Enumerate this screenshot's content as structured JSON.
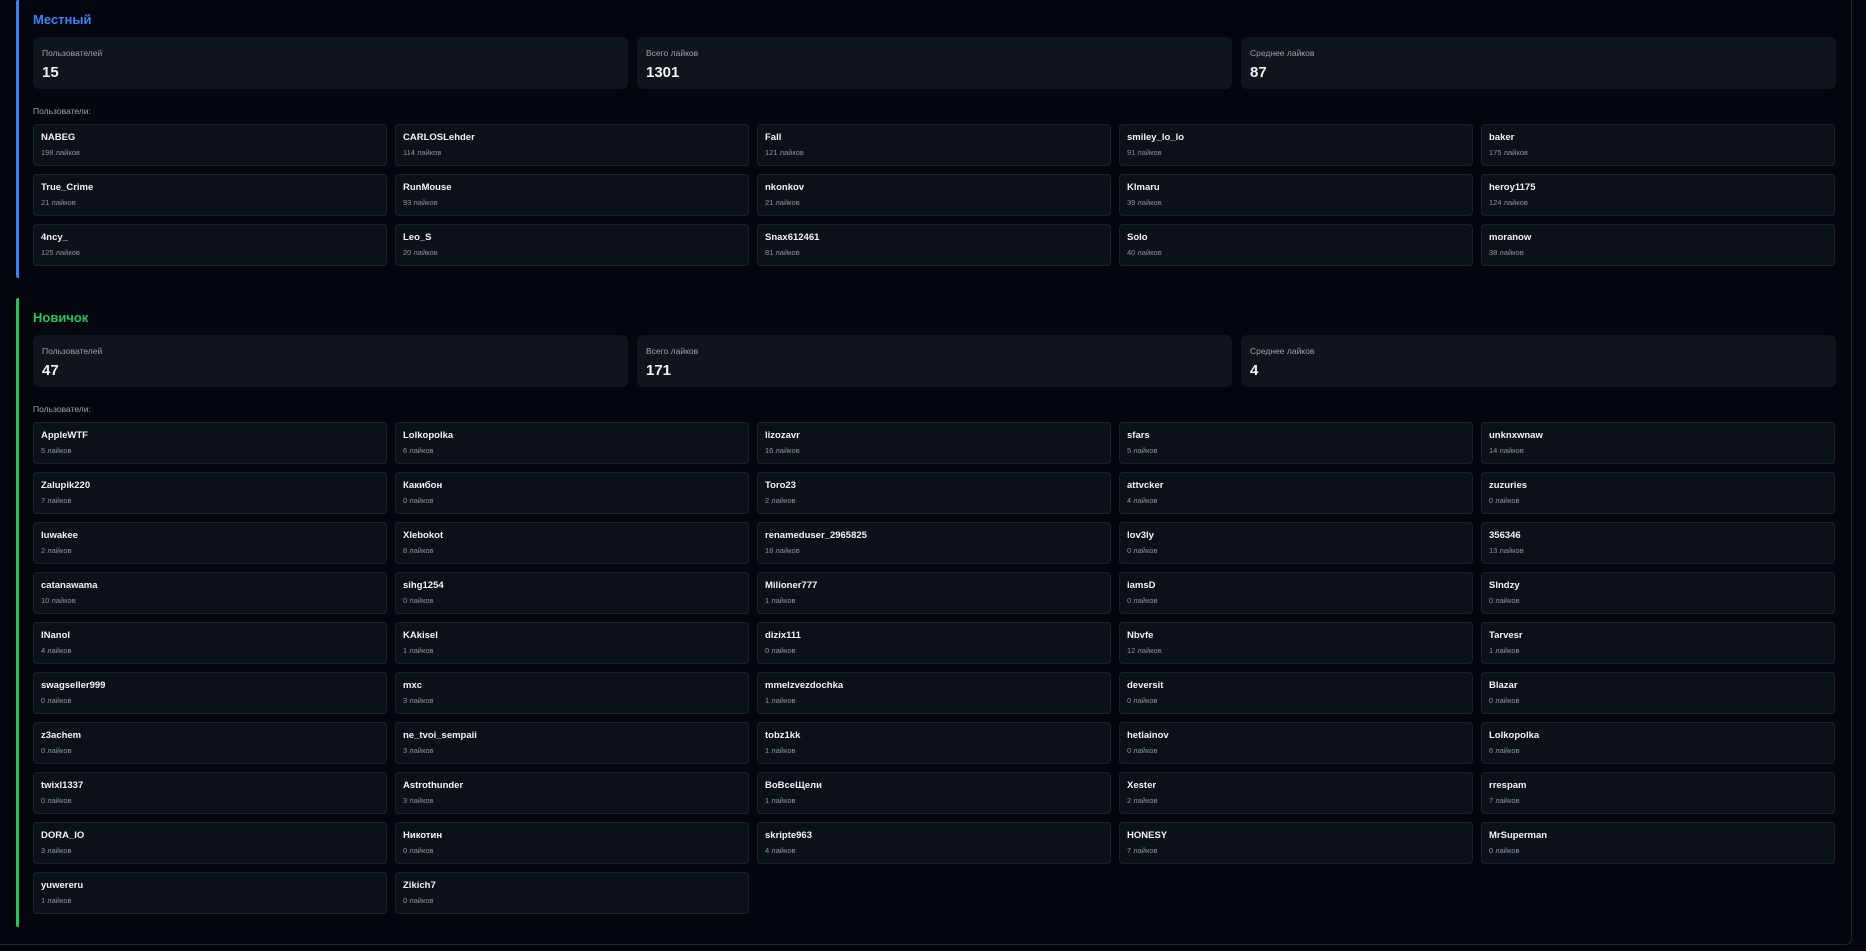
{
  "colors": {
    "background": "#04060d",
    "local_accent": "#3b82f6",
    "newbie_accent": "#22c55e"
  },
  "groups": [
    {
      "title": "Местный",
      "stats": [
        {
          "label": "Пользователей",
          "value": "15"
        },
        {
          "label": "Всего лайков",
          "value": "1301"
        },
        {
          "label": "Среднее лайков",
          "value": "87"
        }
      ],
      "users_label": "Пользователи:",
      "users": [
        {
          "name": "NABEG",
          "likes": "198 лайков"
        },
        {
          "name": "CARLOSLehder",
          "likes": "114 лайков"
        },
        {
          "name": "Fall",
          "likes": "121 лайков"
        },
        {
          "name": "smiley_lo_lo",
          "likes": "91 лайков"
        },
        {
          "name": "baker",
          "likes": "175 лайков"
        },
        {
          "name": "True_Crime",
          "likes": "21 лайков"
        },
        {
          "name": "RunMouse",
          "likes": "93 лайков"
        },
        {
          "name": "nkonkov",
          "likes": "21 лайков"
        },
        {
          "name": "Klmaru",
          "likes": "39 лайков"
        },
        {
          "name": "heroy1175",
          "likes": "124 лайков"
        },
        {
          "name": "4ncy_",
          "likes": "125 лайков"
        },
        {
          "name": "Leo_S",
          "likes": "20 лайков"
        },
        {
          "name": "Snax612461",
          "likes": "81 лайков"
        },
        {
          "name": "Solo",
          "likes": "40 лайков"
        },
        {
          "name": "moranow",
          "likes": "38 лайков"
        }
      ]
    },
    {
      "title": "Новичок",
      "stats": [
        {
          "label": "Пользователей",
          "value": "47"
        },
        {
          "label": "Всего лайков",
          "value": "171"
        },
        {
          "label": "Среднее лайков",
          "value": "4"
        }
      ],
      "users_label": "Пользователи:",
      "users": [
        {
          "name": "AppleWTF",
          "likes": "5 лайков"
        },
        {
          "name": "Lolkopolka",
          "likes": "6 лайков"
        },
        {
          "name": "lizozavr",
          "likes": "16 лайков"
        },
        {
          "name": "sfars",
          "likes": "5 лайков"
        },
        {
          "name": "unknxwnaw",
          "likes": "14 лайков"
        },
        {
          "name": "Zalupik220",
          "likes": "7 лайков"
        },
        {
          "name": "Какибон",
          "likes": "0 лайков"
        },
        {
          "name": "Toro23",
          "likes": "2 лайков"
        },
        {
          "name": "attvcker",
          "likes": "4 лайков"
        },
        {
          "name": "zuzuries",
          "likes": "0 лайков"
        },
        {
          "name": "luwakee",
          "likes": "2 лайков"
        },
        {
          "name": "Xlebokot",
          "likes": "8 лайков"
        },
        {
          "name": "renameduser_2965825",
          "likes": "18 лайков"
        },
        {
          "name": "lov3ly",
          "likes": "0 лайков"
        },
        {
          "name": "356346",
          "likes": "13 лайков"
        },
        {
          "name": "catanawama",
          "likes": "10 лайков"
        },
        {
          "name": "sihg1254",
          "likes": "0 лайков"
        },
        {
          "name": "Milioner777",
          "likes": "1 лайков"
        },
        {
          "name": "iamsD",
          "likes": "0 лайков"
        },
        {
          "name": "Slndzy",
          "likes": "0 лайков"
        },
        {
          "name": "INanol",
          "likes": "4 лайков"
        },
        {
          "name": "KAkisel",
          "likes": "1 лайков"
        },
        {
          "name": "dizix111",
          "likes": "0 лайков"
        },
        {
          "name": "Nbvfe",
          "likes": "12 лайков"
        },
        {
          "name": "Tarvesr",
          "likes": "1 лайков"
        },
        {
          "name": "swagseller999",
          "likes": "0 лайков"
        },
        {
          "name": "mxc",
          "likes": "3 лайков"
        },
        {
          "name": "mmelzvezdochka",
          "likes": "1 лайков"
        },
        {
          "name": "deversit",
          "likes": "0 лайков"
        },
        {
          "name": "Blazar",
          "likes": "0 лайков"
        },
        {
          "name": "z3achem",
          "likes": "0 лайков"
        },
        {
          "name": "ne_tvoi_sempaii",
          "likes": "3 лайков"
        },
        {
          "name": "tobz1kk",
          "likes": "1 лайков"
        },
        {
          "name": "hetlainov",
          "likes": "0 лайков"
        },
        {
          "name": "Lolkopolka",
          "likes": "6 лайков"
        },
        {
          "name": "twixl1337",
          "likes": "0 лайков"
        },
        {
          "name": "Astrothunder",
          "likes": "3 лайков"
        },
        {
          "name": "BoВсеЩели",
          "likes": "1 лайков"
        },
        {
          "name": "Xester",
          "likes": "2 лайков"
        },
        {
          "name": "rrespam",
          "likes": "7 лайков"
        },
        {
          "name": "DORA_IO",
          "likes": "3 лайков"
        },
        {
          "name": "Никотин",
          "likes": "0 лайков"
        },
        {
          "name": "skripte963",
          "likes": "4 лайков"
        },
        {
          "name": "HONESY",
          "likes": "7 лайков"
        },
        {
          "name": "MrSuperman",
          "likes": "0 лайков"
        },
        {
          "name": "yuwereru",
          "likes": "1 лайков"
        },
        {
          "name": "Zikich7",
          "likes": "0 лайков"
        }
      ]
    }
  ]
}
